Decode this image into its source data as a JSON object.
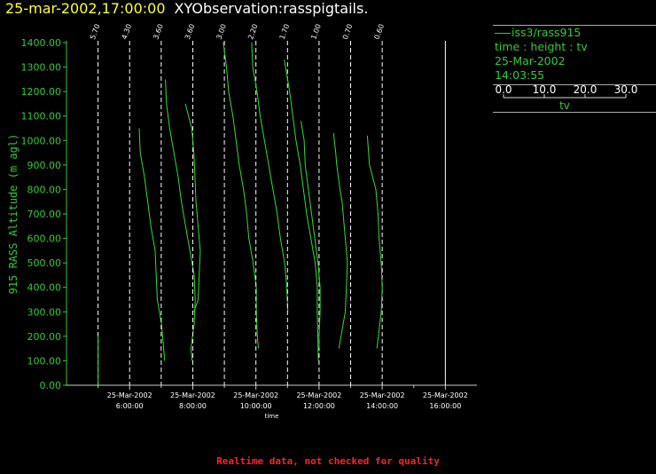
{
  "header": {
    "timestamp": "25-mar-2002,17:00:00",
    "name": "XYObservation:rasspigtails."
  },
  "legend": {
    "series": "iss3/rass915",
    "fields": "time : height : tv",
    "date": "25-Mar-2002",
    "time": "14:03:55",
    "scale_ticks": [
      "0.0",
      "10.0",
      "20.0",
      "30.0"
    ],
    "scale_label": "tv"
  },
  "footer": {
    "note": "Realtime data, not checked for quality"
  },
  "colors": {
    "trace": "#33dd33",
    "axis": "#33cc33",
    "title_stamp": "#ffff33",
    "footer": "#ff2222"
  },
  "chart_data": {
    "type": "line",
    "title": "",
    "ylabel": "915 RASS Altitude (m agl)",
    "xlabel": "time",
    "ylim": [
      0,
      1400
    ],
    "yticks": [
      "0.00",
      "100.00",
      "200.00",
      "300.00",
      "400.00",
      "500.00",
      "600.00",
      "700.00",
      "800.00",
      "900.00",
      "1000.00",
      "1100.00",
      "1200.00",
      "1300.00",
      "1400.00"
    ],
    "xlim_hours": [
      4.0,
      17.0
    ],
    "xticks": [
      {
        "hour": 6,
        "date": "25-Mar-2002",
        "time": "6:00:00"
      },
      {
        "hour": 8,
        "date": "25-Mar-2002",
        "time": "8:00:00"
      },
      {
        "hour": 10,
        "date": "25-Mar-2002",
        "time": "10:00:00"
      },
      {
        "hour": 12,
        "date": "25-Mar-2002",
        "time": "12:00:00"
      },
      {
        "hour": 14,
        "date": "25-Mar-2002",
        "time": "14:00:00"
      },
      {
        "hour": 16,
        "date": "25-Mar-2002",
        "time": "16:00:00"
      }
    ],
    "profiles": [
      {
        "label": "5.70",
        "base_hour": 5.0,
        "start": {
          "v": 0,
          "h": 200
        },
        "points": [
          [
            0,
            200
          ],
          [
            0,
            0
          ]
        ]
      },
      {
        "label": "4.30",
        "base_hour": 6.0,
        "start": {
          "v": 0,
          "h": 1050
        },
        "points": [
          [
            9,
            1050
          ],
          [
            10,
            950
          ],
          [
            14,
            850
          ],
          [
            17,
            750
          ],
          [
            20,
            650
          ],
          [
            24,
            550
          ],
          [
            25,
            450
          ],
          [
            26,
            350
          ],
          [
            30,
            250
          ],
          [
            32,
            150
          ],
          [
            33,
            100
          ]
        ]
      },
      {
        "label": "3.60",
        "base_hour": 7.0,
        "start": {
          "v": 0,
          "h": 1250
        },
        "points": [
          [
            4,
            1250
          ],
          [
            5,
            1150
          ],
          [
            8,
            1050
          ],
          [
            12,
            950
          ],
          [
            16,
            850
          ],
          [
            19,
            750
          ],
          [
            23,
            650
          ],
          [
            27,
            550
          ],
          [
            31,
            450
          ],
          [
            32,
            350
          ],
          [
            31,
            250
          ],
          [
            28,
            150
          ],
          [
            29,
            100
          ]
        ]
      },
      {
        "label": "3.60",
        "base_hour": 8.0,
        "start": {
          "v": 0,
          "h": 1150
        },
        "points": [
          [
            -7,
            1150
          ],
          [
            -1,
            1050
          ],
          [
            1,
            950
          ],
          [
            2,
            850
          ],
          [
            3,
            750
          ],
          [
            5,
            650
          ],
          [
            7,
            550
          ],
          [
            6,
            450
          ],
          [
            5,
            350
          ],
          [
            1,
            300
          ]
        ]
      },
      {
        "label": "3.00",
        "base_hour": 9.0,
        "start": {
          "v": 0,
          "h": 1400
        },
        "points": [
          [
            -1,
            1400
          ],
          [
            2,
            1300
          ],
          [
            4,
            1200
          ],
          [
            8,
            1100
          ],
          [
            11,
            1000
          ],
          [
            14,
            900
          ],
          [
            18,
            800
          ],
          [
            21,
            700
          ],
          [
            23,
            600
          ],
          [
            27,
            500
          ],
          [
            30,
            400
          ],
          [
            30,
            300
          ],
          [
            31,
            200
          ],
          [
            32,
            150
          ]
        ]
      },
      {
        "label": "2.20",
        "base_hour": 10.0,
        "start": {
          "v": 0,
          "h": 1400
        },
        "points": [
          [
            -4,
            1400
          ],
          [
            -3,
            1300
          ],
          [
            1,
            1200
          ],
          [
            4,
            1100
          ],
          [
            8,
            1000
          ],
          [
            12,
            900
          ],
          [
            16,
            800
          ],
          [
            20,
            700
          ],
          [
            23,
            600
          ],
          [
            27,
            500
          ],
          [
            29,
            400
          ],
          [
            30,
            300
          ]
        ]
      },
      {
        "label": "1.70",
        "base_hour": 11.0,
        "start": {
          "v": 0,
          "h": 1330
        },
        "points": [
          [
            -3,
            1330
          ],
          [
            2,
            1200
          ],
          [
            5,
            1100
          ],
          [
            8,
            1000
          ],
          [
            12,
            900
          ],
          [
            15,
            800
          ],
          [
            18,
            700
          ],
          [
            22,
            600
          ],
          [
            26,
            500
          ],
          [
            28,
            400
          ],
          [
            28,
            300
          ],
          [
            29,
            100
          ]
        ]
      },
      {
        "label": "1.00",
        "base_hour": 12.0,
        "start": {
          "v": 0,
          "h": 1080
        },
        "points": [
          [
            -17,
            1080
          ],
          [
            -14,
            1000
          ],
          [
            -13,
            900
          ],
          [
            -10,
            800
          ],
          [
            -7,
            700
          ],
          [
            -4,
            600
          ],
          [
            -1,
            500
          ],
          [
            1,
            400
          ],
          [
            1,
            300
          ],
          [
            0,
            200
          ],
          [
            0,
            150
          ]
        ]
      },
      {
        "label": "0.70",
        "base_hour": 13.0,
        "start": {
          "v": 0,
          "h": 1050
        },
        "points": [
          [
            -16,
            1030
          ],
          [
            -14,
            950
          ],
          [
            -13,
            900
          ],
          [
            -10,
            800
          ],
          [
            -8,
            750
          ],
          [
            -7,
            700
          ],
          [
            -5,
            600
          ],
          [
            -3,
            500
          ],
          [
            -4,
            400
          ],
          [
            -5,
            300
          ],
          [
            -7,
            250
          ],
          [
            -11,
            150
          ]
        ]
      },
      {
        "label": "0.60",
        "base_hour": 14.0,
        "start": {
          "v": 0,
          "h": 1020
        },
        "points": [
          [
            -14,
            1020
          ],
          [
            -12,
            900
          ],
          [
            -9,
            850
          ],
          [
            -6,
            800
          ],
          [
            -4,
            700
          ],
          [
            -3,
            600
          ],
          [
            -1,
            500
          ],
          [
            0,
            400
          ],
          [
            -1,
            300
          ],
          [
            -5,
            150
          ]
        ]
      },
      {
        "label": "",
        "base_hour": 16.0,
        "start": {
          "v": 0,
          "h": 0
        },
        "points": []
      }
    ]
  }
}
